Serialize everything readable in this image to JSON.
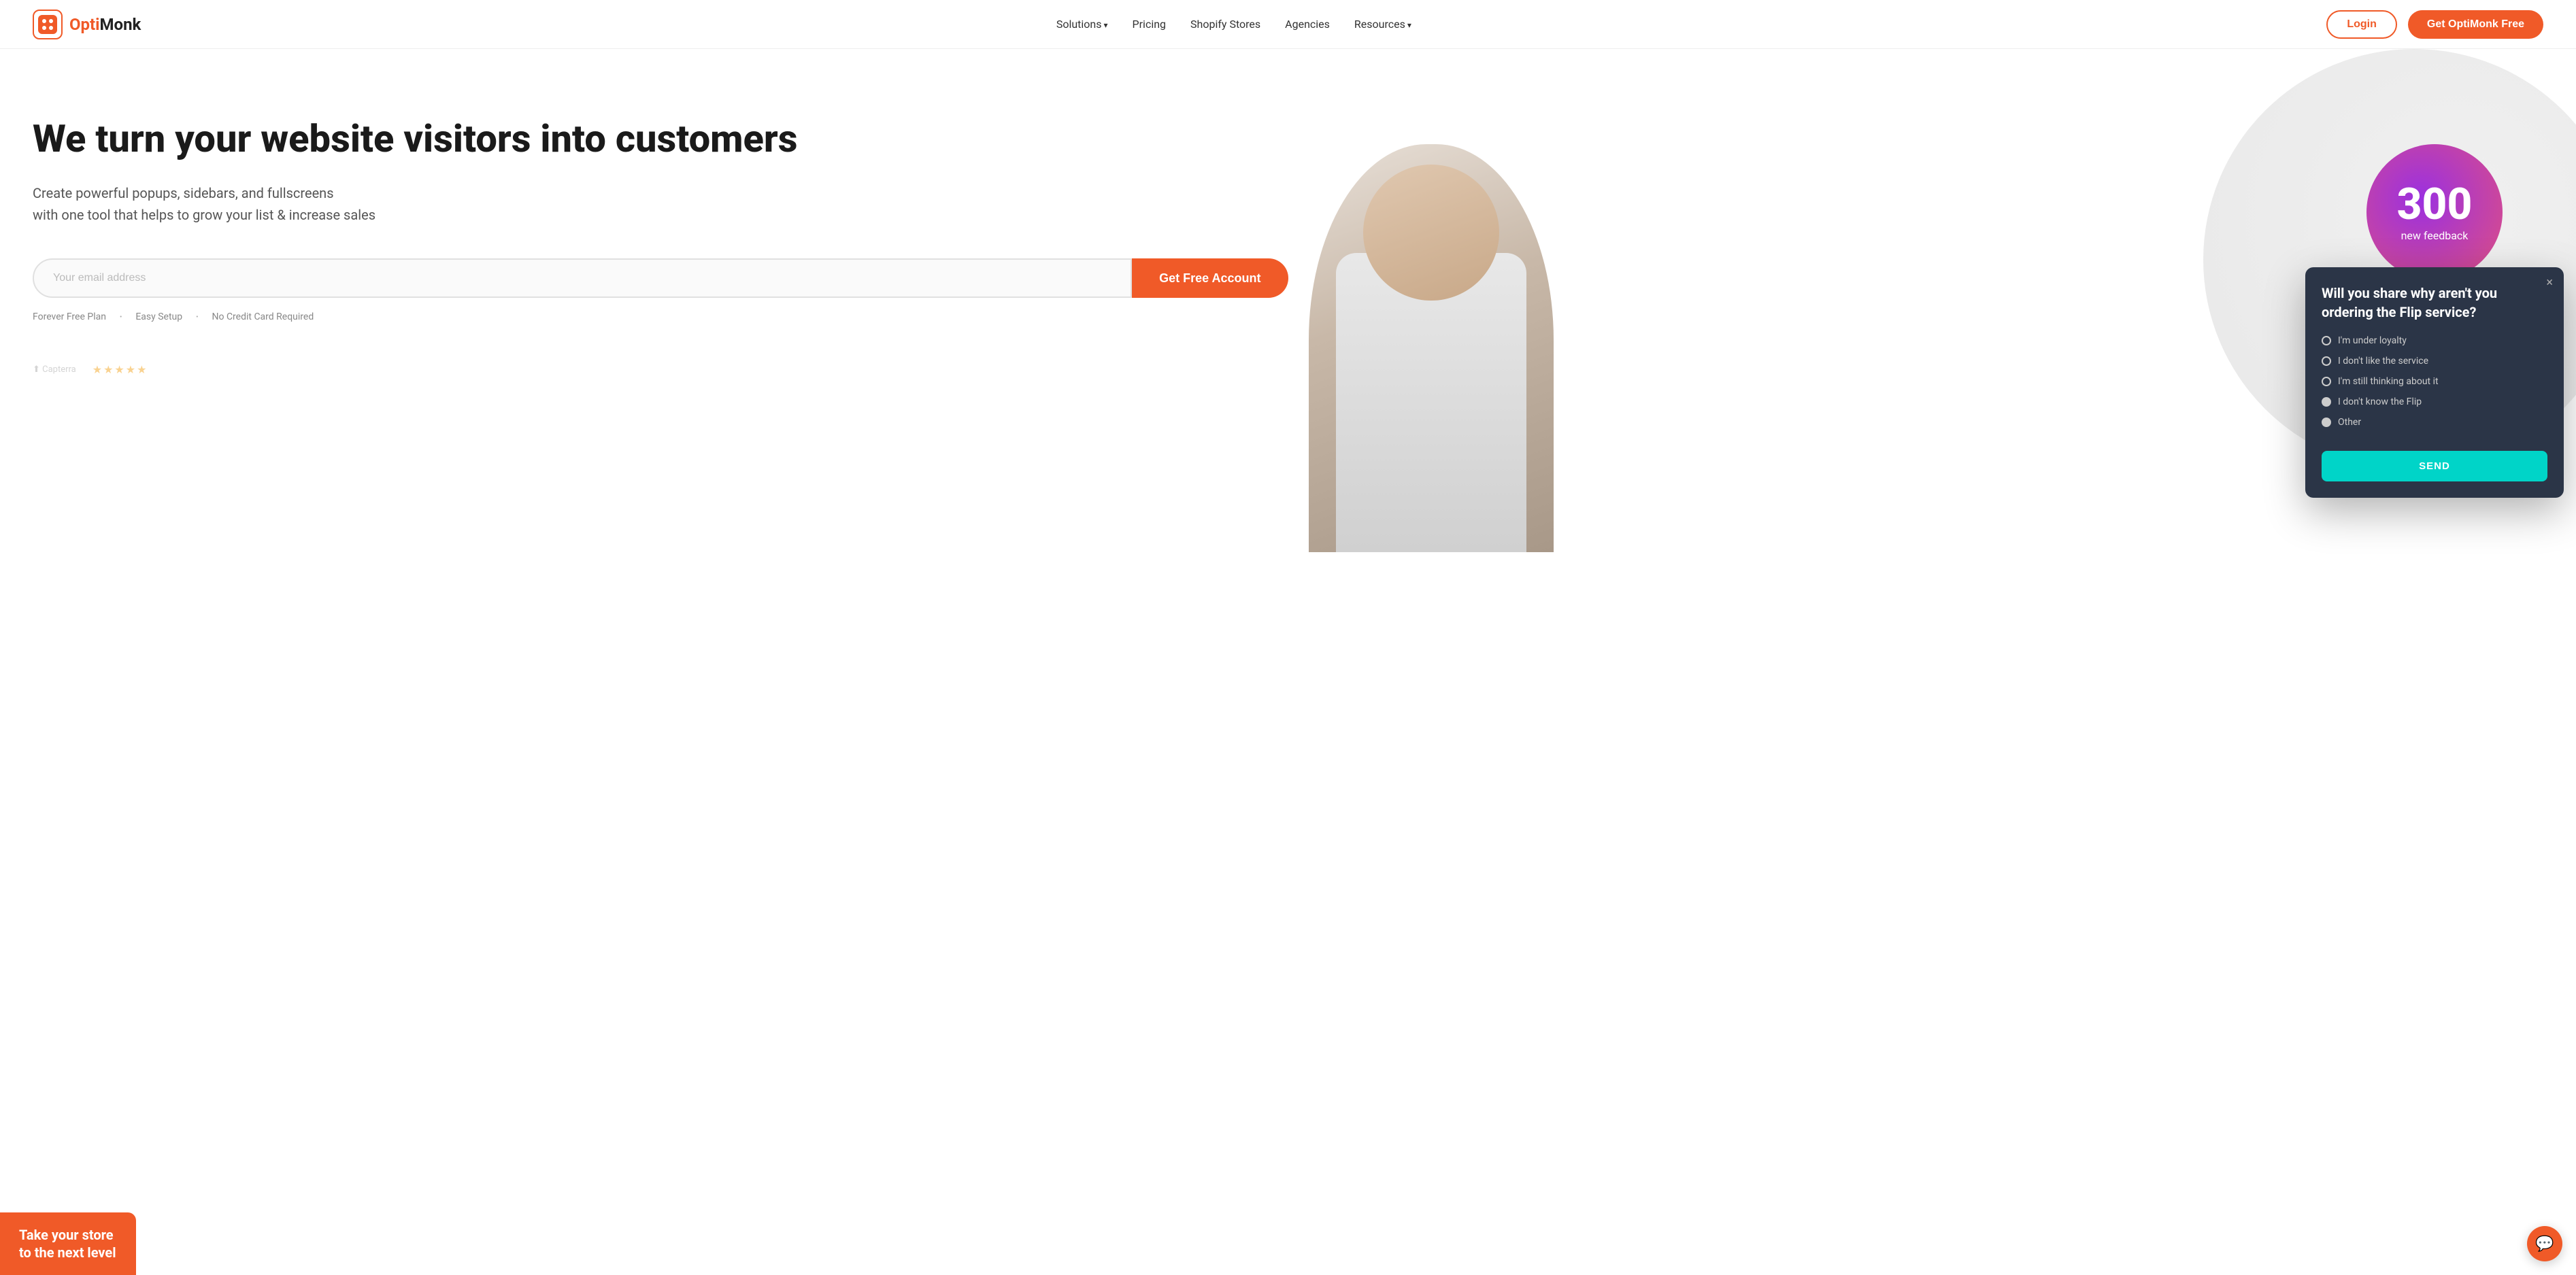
{
  "brand": {
    "name_part1": "Opti",
    "name_part2": "Monk",
    "logo_alt": "OptiMonk logo"
  },
  "nav": {
    "links": [
      {
        "label": "Solutions",
        "has_arrow": true
      },
      {
        "label": "Pricing",
        "has_arrow": false
      },
      {
        "label": "Shopify Stores",
        "has_arrow": false
      },
      {
        "label": "Agencies",
        "has_arrow": false
      },
      {
        "label": "Resources",
        "has_arrow": true
      }
    ],
    "login_label": "Login",
    "cta_label": "Get OptiMonk Free"
  },
  "hero": {
    "headline": "We turn your website visitors into customers",
    "subheadline": "Create powerful popups, sidebars, and fullscreens\nwith one tool that helps to grow your list & increase sales",
    "email_placeholder": "Your email address",
    "cta_label": "Get Free Account",
    "features": [
      "Forever Free Plan",
      "Easy Setup",
      "No Credit Card Required"
    ]
  },
  "stat": {
    "number": "300",
    "label": "new feedback"
  },
  "popup": {
    "close_char": "×",
    "title": "Will you share why aren't you ordering the Flip service?",
    "options": [
      {
        "label": "I'm under loyalty",
        "filled": false
      },
      {
        "label": "I don't like the service",
        "filled": false
      },
      {
        "label": "I'm still thinking about it",
        "filled": false
      },
      {
        "label": "I don't know the Flip",
        "filled": true
      },
      {
        "label": "Other",
        "filled": true
      }
    ],
    "send_label": "SEND"
  },
  "bottom_bar": {
    "text": "Take your store to the next level"
  },
  "chat": {
    "icon": "💬"
  }
}
